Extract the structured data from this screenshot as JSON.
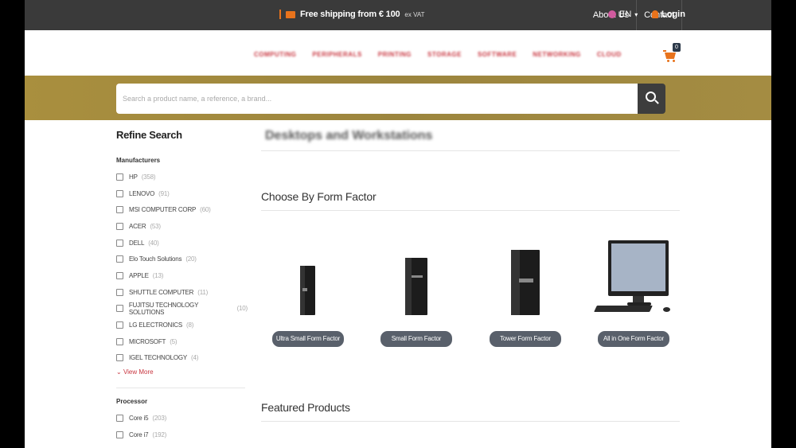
{
  "topbar": {
    "shipping_text": "Free shipping from € 100",
    "shipping_suffix": "ex VAT",
    "about": "About Us",
    "contact": "Contact",
    "language": "EN",
    "login": "Login"
  },
  "nav": {
    "items": [
      "COMPUTING",
      "PERIPHERALS",
      "PRINTING",
      "STORAGE",
      "SOFTWARE",
      "NETWORKING",
      "CLOUD"
    ],
    "cart_count": "0"
  },
  "search": {
    "placeholder": "Search a product name, a reference, a brand..."
  },
  "sidebar": {
    "title": "Refine Search",
    "manufacturers_title": "Manufacturers",
    "manufacturers": [
      {
        "name": "HP",
        "count": "(358)"
      },
      {
        "name": "LENOVO",
        "count": "(91)"
      },
      {
        "name": "MSI COMPUTER CORP",
        "count": "(60)"
      },
      {
        "name": "ACER",
        "count": "(53)"
      },
      {
        "name": "DELL",
        "count": "(40)"
      },
      {
        "name": "Elo Touch Solutions",
        "count": "(20)"
      },
      {
        "name": "APPLE",
        "count": "(13)"
      },
      {
        "name": "SHUTTLE COMPUTER",
        "count": "(11)"
      },
      {
        "name": "FUJITSU TECHNOLOGY SOLUTIONS",
        "count": "(10)"
      },
      {
        "name": "LG ELECTRONICS",
        "count": "(8)"
      },
      {
        "name": "MICROSOFT",
        "count": "(5)"
      },
      {
        "name": "IGEL TECHNOLOGY",
        "count": "(4)"
      }
    ],
    "view_more": "View More",
    "processor_title": "Processor",
    "processors": [
      {
        "name": "Core i5",
        "count": "(203)"
      },
      {
        "name": "Core i7",
        "count": "(192)"
      }
    ]
  },
  "main": {
    "category_title": "Desktops and Workstations",
    "form_factor_title": "Choose By Form Factor",
    "form_factors": [
      "Ultra Small Form Factor",
      "Small Form Factor",
      "Tower Form Factor",
      "All in One Form Factor"
    ],
    "featured_title": "Featured Products"
  },
  "colors": {
    "accent": "#e8731c",
    "nav_red": "#c8353f",
    "band_gold": "#a48c42",
    "pill": "#59606b"
  }
}
